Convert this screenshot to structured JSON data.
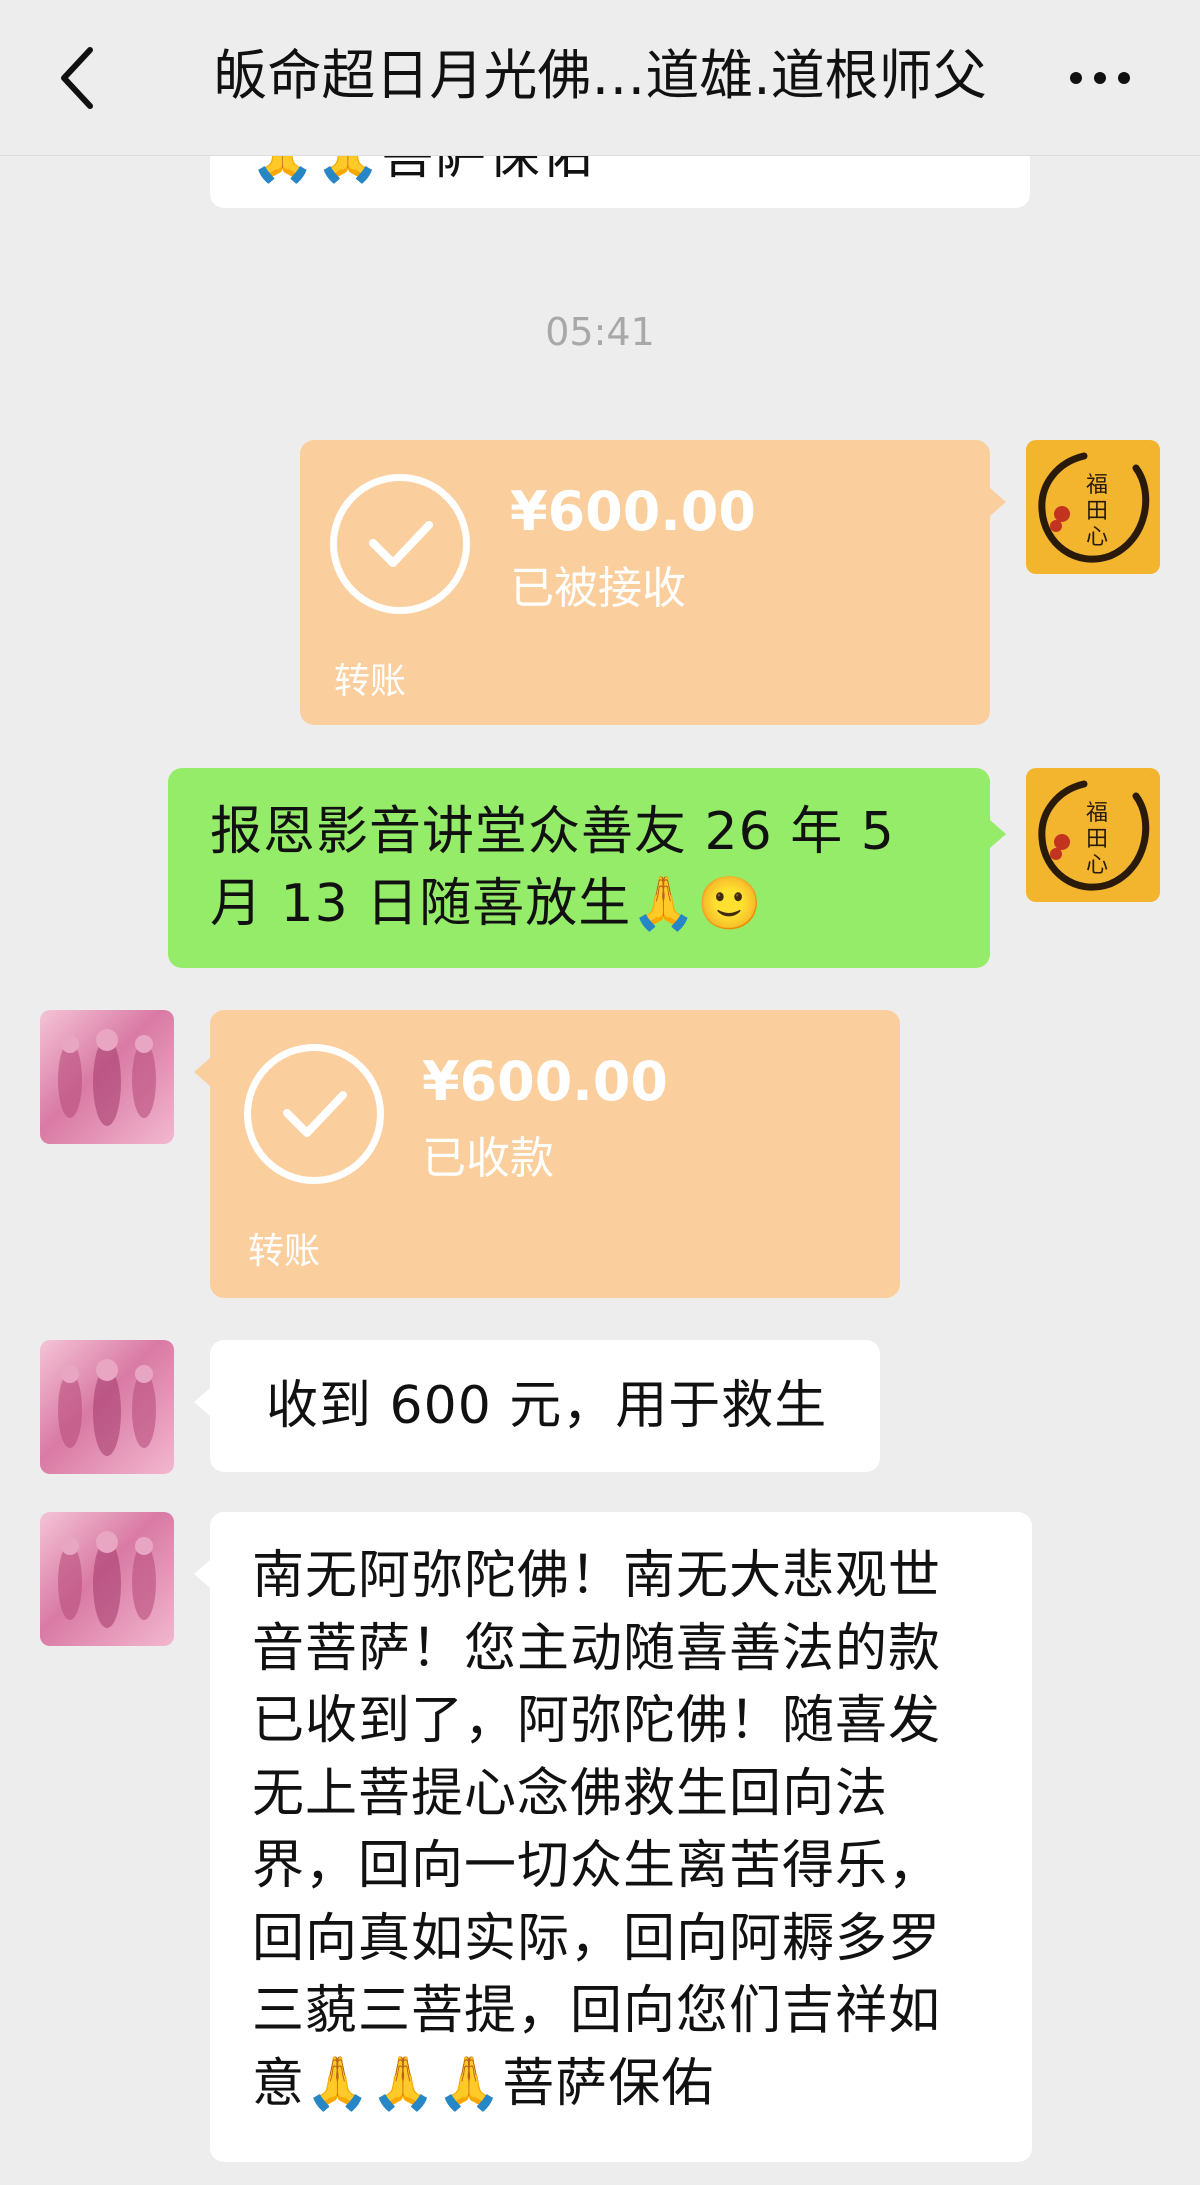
{
  "header": {
    "back_icon": "chevron-left-icon",
    "title": "皈命超日月光佛…道雄.道根师父",
    "more_icon": "more-dots-icon"
  },
  "messages": {
    "top_partial_text": "🙏🙏菩萨保佑",
    "timestamp": "05:41",
    "transfer_sent": {
      "amount": "¥600.00",
      "status": "已被接收",
      "label": "转账"
    },
    "green_text": "报恩影音讲堂众善友 26 年 5 月 13 日随喜放生🙏🙂",
    "transfer_received": {
      "amount": "¥600.00",
      "status": "已收款",
      "label": "转账"
    },
    "reply_short": "收到 600 元，用于救生",
    "reply_long": "南无阿弥陀佛！南无大悲观世音菩萨！您主动随喜善法的款已收到了，阿弥陀佛！随喜发无上菩提心念佛救生回向法界，回向一切众生离苦得乐，回向真如实际，回向阿耨多罗三藐三菩提，回向您们吉祥如意🙏🙏🙏菩萨保佑"
  },
  "avatars": {
    "me_seal_text": "福田心耕",
    "colors": {
      "me": "#f2b52d",
      "other": "#d97aa4"
    }
  },
  "colors": {
    "background": "#ededed",
    "green_bubble": "#95ec69",
    "transfer_bubble": "#fbcf9d"
  }
}
